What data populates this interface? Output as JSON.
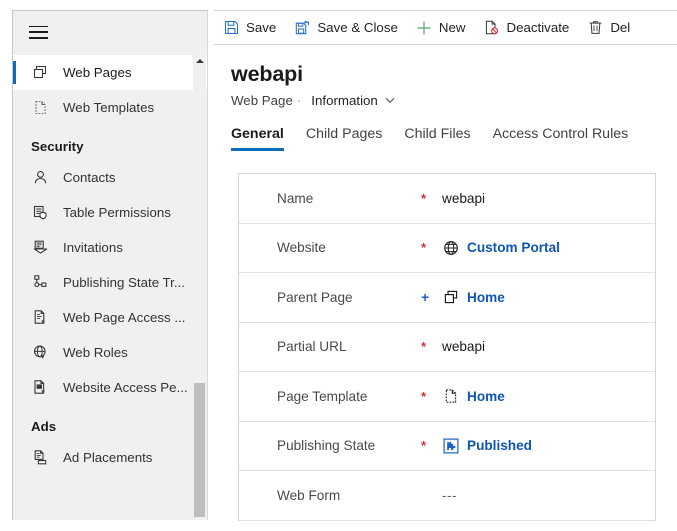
{
  "sidebar": {
    "menu_button": "hamburger-menu",
    "items": [
      {
        "label": "Web Pages",
        "icon": "web-pages-icon",
        "selected": true,
        "group": null
      },
      {
        "label": "Web Templates",
        "icon": "web-templates-icon",
        "selected": false,
        "group": null
      },
      {
        "label": "Security",
        "icon": null,
        "selected": false,
        "group": "header"
      },
      {
        "label": "Contacts",
        "icon": "contact-person-icon",
        "selected": false,
        "group": null
      },
      {
        "label": "Table  Permissions",
        "icon": "table-permissions-icon",
        "selected": false,
        "group": null
      },
      {
        "label": "Invitations",
        "icon": "invitations-icon",
        "selected": false,
        "group": null
      },
      {
        "label": "Publishing State Tr...",
        "icon": "publishing-state-transition-icon",
        "selected": false,
        "group": null
      },
      {
        "label": "Web Page Access ...",
        "icon": "web-page-access-icon",
        "selected": false,
        "group": null
      },
      {
        "label": "Web Roles",
        "icon": "web-roles-icon",
        "selected": false,
        "group": null
      },
      {
        "label": "Website Access Pe...",
        "icon": "website-access-permission-icon",
        "selected": false,
        "group": null
      },
      {
        "label": "Ads",
        "icon": null,
        "selected": false,
        "group": "header"
      },
      {
        "label": "Ad Placements",
        "icon": "ad-placements-icon",
        "selected": false,
        "group": null
      }
    ],
    "scrollbar": {
      "up_arrow": "scroll-up-arrow"
    }
  },
  "commandbar": {
    "buttons": [
      {
        "label": "Save",
        "icon": "save-icon"
      },
      {
        "label": "Save & Close",
        "icon": "save-and-close-icon"
      },
      {
        "label": "New",
        "icon": "plus-icon"
      },
      {
        "label": "Deactivate",
        "icon": "deactivate-icon"
      },
      {
        "label": "Del",
        "icon": "trash-icon"
      }
    ]
  },
  "record": {
    "title": "webapi",
    "entity": "Web Page",
    "separator": "·",
    "form_name": "Information",
    "form_chevron": "chevron-down-icon"
  },
  "tabs": [
    {
      "label": "General",
      "active": true
    },
    {
      "label": "Child Pages",
      "active": false
    },
    {
      "label": "Child Files",
      "active": false
    },
    {
      "label": "Access Control Rules",
      "active": false
    }
  ],
  "form": {
    "fields": [
      {
        "label": "Name",
        "required": "*",
        "required_kind": "required",
        "value": "webapi",
        "icon": null,
        "link": false
      },
      {
        "label": "Website",
        "required": "*",
        "required_kind": "required",
        "value": "Custom Portal",
        "icon": "globe-icon",
        "link": true
      },
      {
        "label": "Parent Page",
        "required": "+",
        "required_kind": "recommended",
        "value": "Home",
        "icon": "web-pages-icon",
        "link": true
      },
      {
        "label": "Partial URL",
        "required": "*",
        "required_kind": "required",
        "value": "webapi",
        "icon": null,
        "link": false
      },
      {
        "label": "Page Template",
        "required": "*",
        "required_kind": "required",
        "value": "Home",
        "icon": "page-template-icon",
        "link": true
      },
      {
        "label": "Publishing State",
        "required": "*",
        "required_kind": "required",
        "value": "Published",
        "icon": "publishing-state-icon",
        "link": true
      },
      {
        "label": "Web Form",
        "required": "",
        "required_kind": "none",
        "value": "---",
        "icon": null,
        "link": false
      }
    ]
  },
  "colors": {
    "accent": "#0f6cbd",
    "link": "#0f56b3",
    "required": "#d13438",
    "recommended": "#1f5fc7",
    "new_plus": "#6bb38a",
    "sidebar_bg": "#f0f0f0"
  }
}
